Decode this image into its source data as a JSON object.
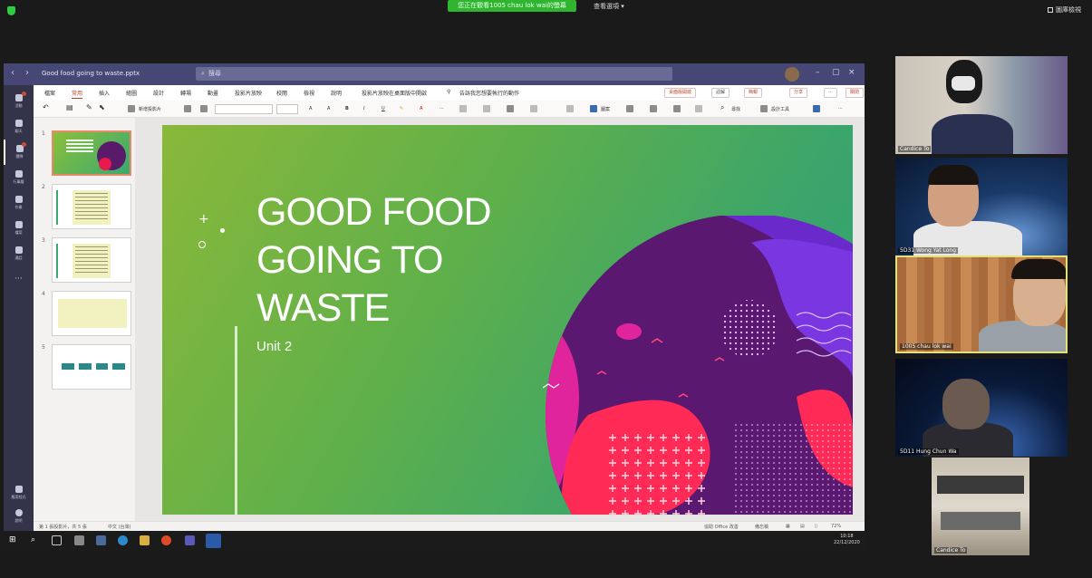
{
  "zoom": {
    "share_banner": "您正在觀看1005 chau lok wai的螢幕",
    "view_options": "查看選項 ▾",
    "gallery_view": "圖庫檢視"
  },
  "teams": {
    "doc_title": "Good food going to waste.pptx",
    "search_placeholder": "搜尋",
    "rail": [
      "活動",
      "聊天",
      "團隊",
      "行事曆",
      "作業",
      "檔案",
      "通話"
    ],
    "rail_bottom": [
      "應用程式",
      "說明"
    ],
    "menu_tabs": [
      "檔案",
      "常用",
      "插入",
      "繪圖",
      "設計",
      "轉場",
      "動畫",
      "投影片放映",
      "校閱",
      "檢視",
      "說明",
      "投影片放映在桌面版中開啟",
      "告訴我您想要執行的動作"
    ],
    "menu_pills": [
      "桌面版開啟",
      "註解",
      "簡報",
      "分享"
    ],
    "close_label": "關閉",
    "ribbon": {
      "new_slide": "新增投影片",
      "search": "尋找",
      "designer": "設計工具",
      "shapes": "圖案"
    },
    "status": {
      "slide_count": "第 1 張投影片，共 5 張",
      "language": "中文 (台灣)",
      "help": "協助 Office 改善",
      "notes": "備忘稿",
      "zoom": "72%"
    }
  },
  "slide": {
    "title": "GOOD FOOD\nGOING TO\nWASTE",
    "subtitle": "Unit 2"
  },
  "taskbar": {
    "time": "10:18",
    "date": "22/12/2020"
  },
  "participants": [
    {
      "name": "Candice To"
    },
    {
      "name": "5D31 Wong Yat Long"
    },
    {
      "name": "1005 chau lok wai"
    },
    {
      "name": "5D11 Hung Chun Wa"
    },
    {
      "name": "Candice To"
    }
  ],
  "colors": {
    "teams_purple": "#464775",
    "ppt_accent": "#b7472a",
    "active_speaker": "#e2e27a",
    "share_green": "#2fb52f"
  }
}
